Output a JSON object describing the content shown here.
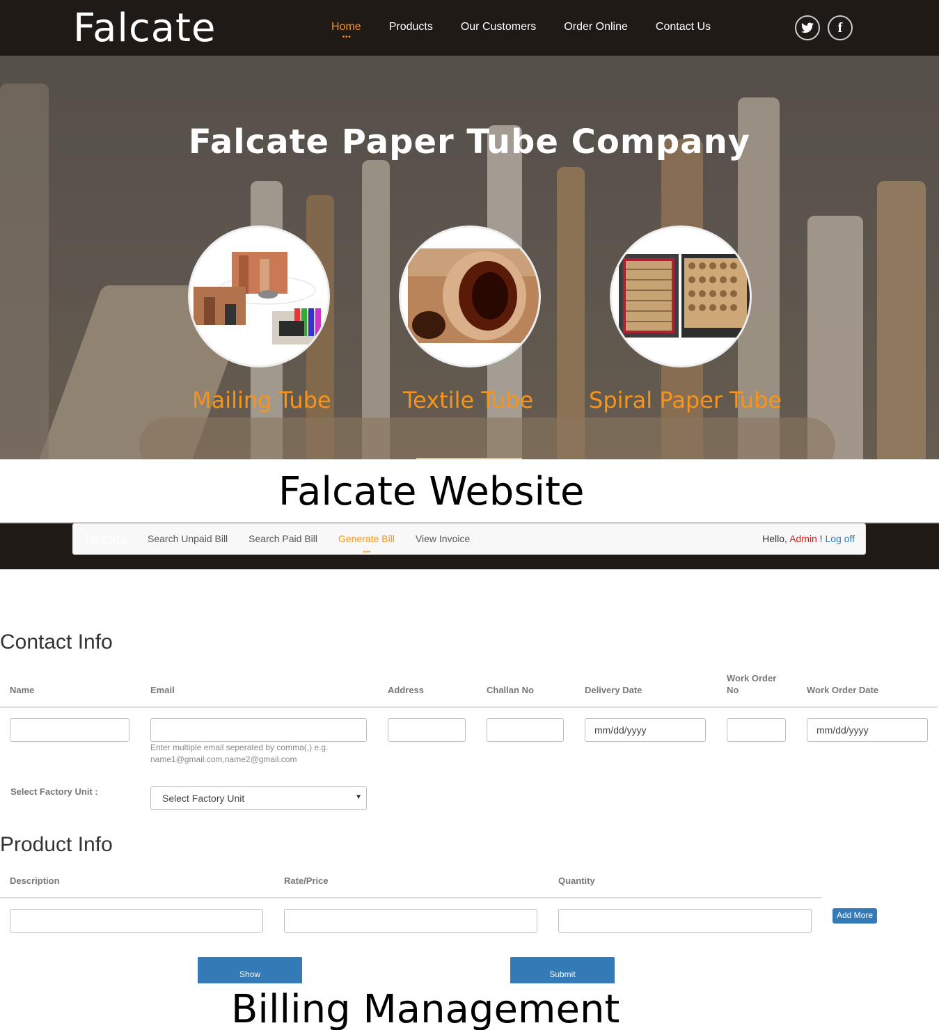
{
  "site": {
    "logo": "Falcate",
    "menu": [
      {
        "label": "Home",
        "active": true
      },
      {
        "label": "Products",
        "active": false
      },
      {
        "label": "Our Customers",
        "active": false
      },
      {
        "label": "Order Online",
        "active": false
      },
      {
        "label": "Contact Us",
        "active": false
      }
    ],
    "social": [
      "twitter-icon",
      "facebook-icon"
    ],
    "facebook_glyph": "f",
    "hero_title": "Falcate Paper Tube Company",
    "products": [
      {
        "label": "Mailing Tube",
        "image": "mailing-tube-image"
      },
      {
        "label": "Textile Tube",
        "image": "textile-tube-image"
      },
      {
        "label": "Spiral Paper Tube",
        "image": "spiral-paper-tube-image"
      }
    ],
    "accent": "#f7941d"
  },
  "captions": {
    "website": "Falcate Website",
    "billing": "Billing Management"
  },
  "billing": {
    "brand": "Falcate",
    "links": [
      {
        "label": "Search Unpaid Bill",
        "active": false
      },
      {
        "label": "Search Paid Bill",
        "active": false
      },
      {
        "label": "Generate Bill",
        "active": true
      },
      {
        "label": "View Invoice",
        "active": false
      }
    ],
    "hello": "Hello,",
    "user": "Admin",
    "exclaim": "!",
    "logoff": "Log off",
    "contact": {
      "title": "Contact Info",
      "columns": [
        "Name",
        "Email",
        "Address",
        "Challan No",
        "Delivery Date",
        "Work Order No",
        "Work Order Date"
      ],
      "delivery_date_placeholder": "mm/dd/yyyy",
      "work_order_date_placeholder": "mm/dd/yyyy",
      "email_help": "Enter multiple email seperated by comma(,) e.g. name1@gmail.com,name2@gmail.com",
      "factory_label": "Select Factory Unit :",
      "factory_selected": "Select Factory Unit"
    },
    "product": {
      "title": "Product Info",
      "columns": [
        "Description",
        "Rate/Price",
        "Quantity"
      ],
      "add_more": "Add More"
    },
    "buttons": {
      "show": "Show",
      "submit": "Submit"
    }
  }
}
